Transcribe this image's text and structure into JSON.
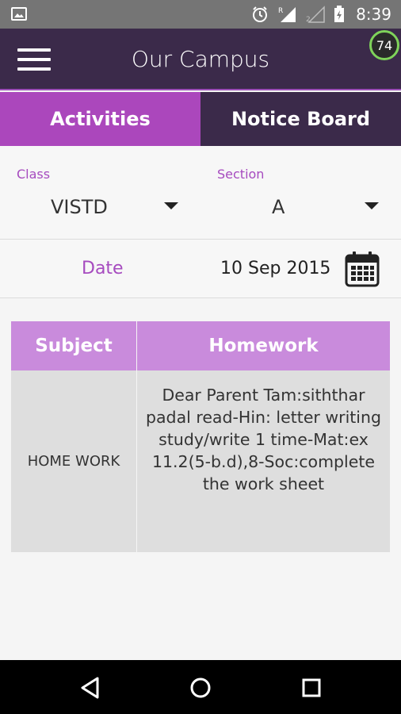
{
  "status_bar": {
    "time": "8:39",
    "icons": [
      "image-icon",
      "alarm-icon",
      "signal-roaming-icon",
      "signal-empty-icon",
      "battery-charging-icon"
    ]
  },
  "app_bar": {
    "title": "Our Campus",
    "badge": "74"
  },
  "tabs": [
    {
      "label": "Activities",
      "active": true
    },
    {
      "label": "Notice Board",
      "active": false
    }
  ],
  "filters": {
    "class_label": "Class",
    "class_value": "VISTD",
    "section_label": "Section",
    "section_value": "A"
  },
  "date": {
    "label": "Date",
    "value": "10 Sep 2015"
  },
  "table": {
    "headers": [
      "Subject",
      "Homework"
    ],
    "rows": [
      {
        "subject": "HOME WORK",
        "homework": "Dear Parent Tam:siththar padal read-Hin: letter writing study/write 1 time-Mat:ex 11.2(5-b.d),8-Soc:complete the work sheet"
      }
    ]
  },
  "colors": {
    "primary_dark": "#3b2a4a",
    "accent": "#ab47bc",
    "header_light": "#c98bdc",
    "label": "#a64bbf"
  }
}
